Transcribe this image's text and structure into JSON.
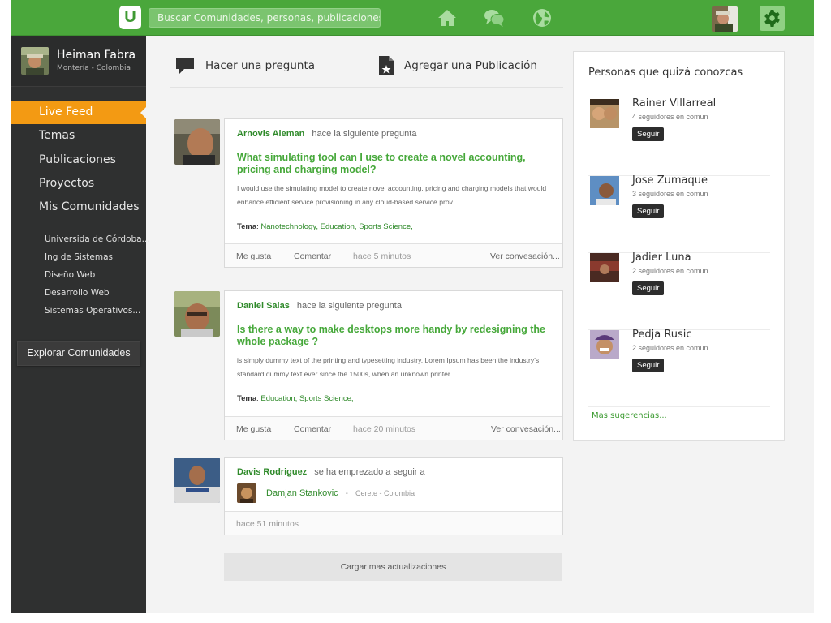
{
  "colors": {
    "brand": "#4aa73b",
    "accent": "#f39a13",
    "link": "#2f8a2a",
    "title_link": "#46a83a",
    "sidebar": "#2f3030"
  },
  "topbar": {
    "logo_letter": "U",
    "search_placeholder": "Buscar Comunidades, personas, publicaciones",
    "icons": [
      "home-icon",
      "chat-bubbles-icon",
      "globe-icon",
      "gear-icon"
    ]
  },
  "profile": {
    "name": "Heiman Fabra",
    "location": "Montería - Colombia"
  },
  "sidebar": {
    "items": [
      {
        "label": "Live Feed",
        "active": true
      },
      {
        "label": "Temas"
      },
      {
        "label": "Publicaciones"
      },
      {
        "label": "Proyectos"
      },
      {
        "label": "Mis Comunidades"
      }
    ],
    "communities": [
      "Universida de Córdoba...",
      "Ing de Sistemas",
      "Diseño Web",
      "Desarrollo Web",
      "Sistemas Operativos..."
    ],
    "explore_label": "Explorar Comunidades"
  },
  "actions": {
    "ask_label": "Hacer una pregunta",
    "publish_label": "Agregar una Publicación"
  },
  "feed": [
    {
      "author": "Arnovis Aleman",
      "verb": "hace la siguiente pregunta",
      "title": "What simulating tool can I use to create a novel accounting, pricing and charging model?",
      "body": "I would use the simulating model to create novel accounting, pricing and charging models that would enhance efficient service provisioning in any cloud-based service prov...",
      "tema_label": "Tema",
      "tags": [
        "Nanotechnology,",
        "Education,",
        "Sports Science,"
      ],
      "like": "Me gusta",
      "comment": "Comentar",
      "time": "hace 5 minutos",
      "view": "Ver convesación..."
    },
    {
      "author": "Daniel Salas",
      "verb": "hace la siguiente pregunta",
      "title": "Is there a way to make desktops more handy by redesigning the whole package ?",
      "body": "is simply dummy text of the printing and typesetting industry. Lorem Ipsum has been the industry's standard dummy text ever since the 1500s, when an unknown printer ..",
      "tema_label": "Tema",
      "tags": [
        "Education,",
        "Sports Science,"
      ],
      "like": "Me gusta",
      "comment": "Comentar",
      "time": "hace 20 minutos",
      "view": "Ver convesación..."
    },
    {
      "author": "Davis Rodriguez",
      "verb": "se ha emprezado a seguir a",
      "target_name": "Damjan Stankovic",
      "target_sep": "-",
      "target_location": "Cerete - Colombia",
      "time": "hace 51 minutos"
    }
  ],
  "load_more": "Cargar mas actualizaciones",
  "suggestions": {
    "title": "Personas que quizá conozcas",
    "people": [
      {
        "name": "Rainer Villarreal",
        "common": "4 seguidores en comun",
        "button": "Seguir"
      },
      {
        "name": "Jose Zumaque",
        "common": "3 seguidores en comun",
        "button": "Seguir"
      },
      {
        "name": "Jadier Luna",
        "common": "2 seguidores en comun",
        "button": "Seguir"
      },
      {
        "name": "Pedja Rusic",
        "common": "2 seguidores en comun",
        "button": "Seguir"
      }
    ],
    "more": "Mas sugerencias..."
  }
}
